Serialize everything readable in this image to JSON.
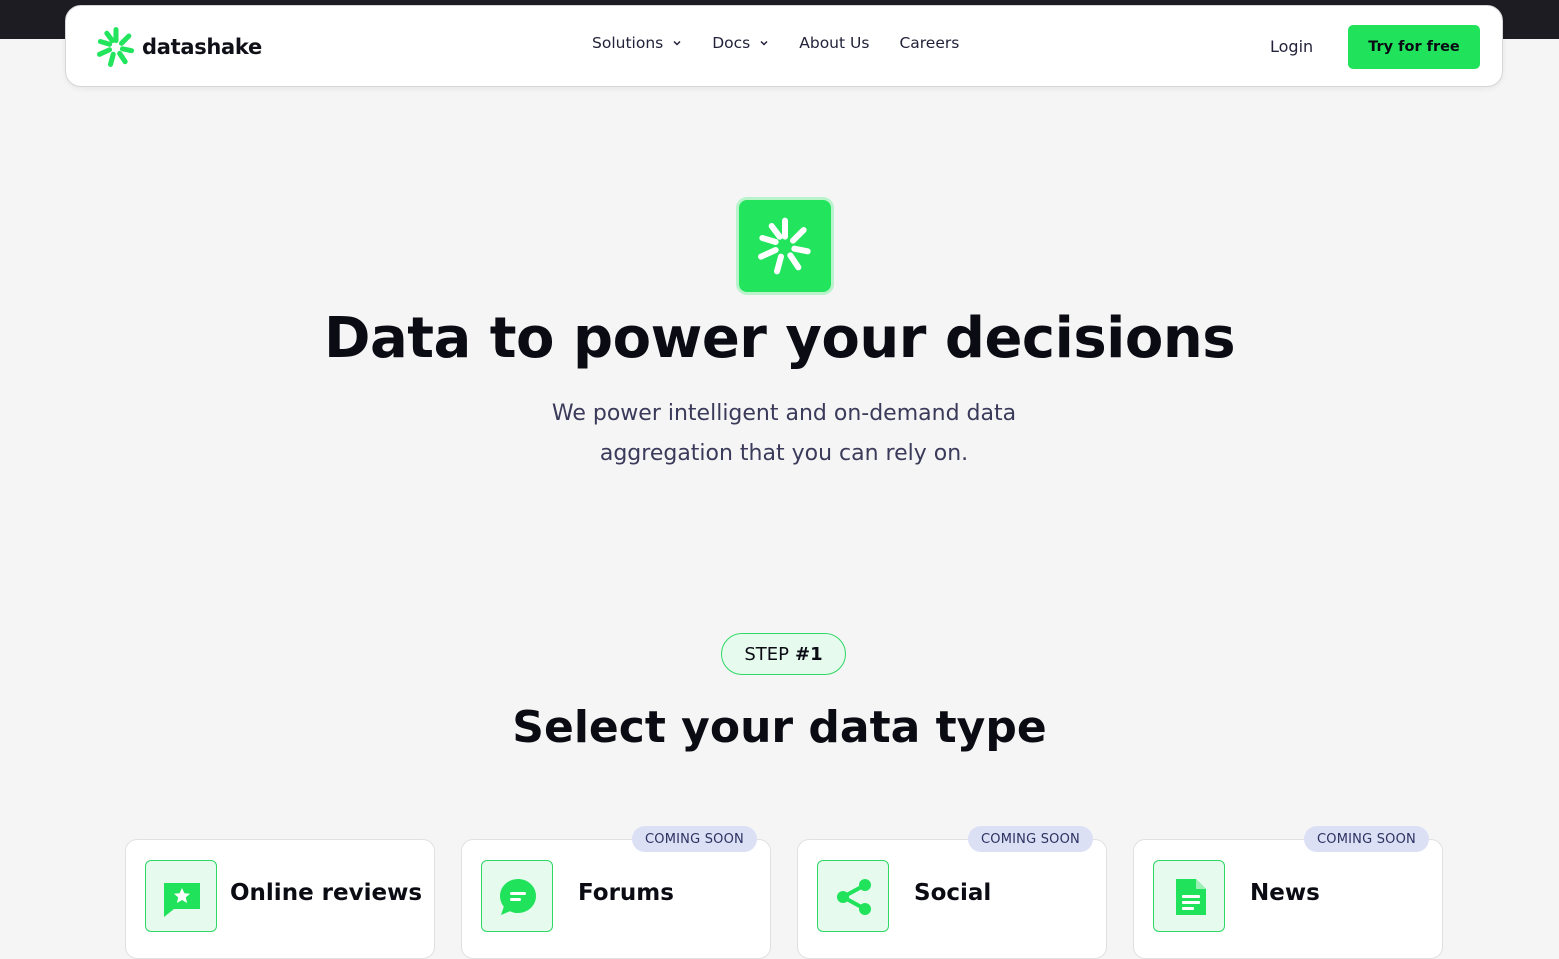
{
  "brand": {
    "name": "datashake",
    "color": "#21e35b"
  },
  "nav": {
    "links": [
      {
        "label": "Solutions",
        "has_dropdown": true
      },
      {
        "label": "Docs",
        "has_dropdown": true
      },
      {
        "label": "About Us",
        "has_dropdown": false
      },
      {
        "label": "Careers",
        "has_dropdown": false
      }
    ],
    "login_label": "Login",
    "cta_label": "Try for free"
  },
  "hero": {
    "title": "Data to power your decisions",
    "subtitle_line1": "We power intelligent and on-demand data",
    "subtitle_line2": "aggregation that you can rely on."
  },
  "step": {
    "prefix": "STEP",
    "number": "#1",
    "title": "Select your data type"
  },
  "cards": [
    {
      "label": "Online reviews",
      "icon": "review-star-icon",
      "badge": ""
    },
    {
      "label": "Forums",
      "icon": "chat-bubble-icon",
      "badge": "COMING SOON"
    },
    {
      "label": "Social",
      "icon": "share-icon",
      "badge": "COMING SOON"
    },
    {
      "label": "News",
      "icon": "document-icon",
      "badge": "COMING SOON"
    }
  ]
}
